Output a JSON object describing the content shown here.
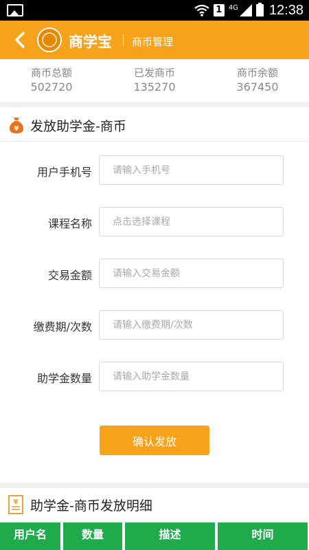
{
  "status_bar": {
    "network": "4G",
    "sim": "1",
    "time": "12:38"
  },
  "header": {
    "back_icon": "chevron-left-icon",
    "logo_icon": "shangxuebao-logo-icon",
    "brand": "商学宝",
    "subtitle": "商币管理",
    "color": "#f7a21b"
  },
  "stats": [
    {
      "label": "商币总额",
      "value": "502720"
    },
    {
      "label": "已发商币",
      "value": "135270"
    },
    {
      "label": "商币余额",
      "value": "367450"
    }
  ],
  "issue_section": {
    "icon": "money-bag-icon",
    "title": "发放助学金-商币",
    "fields": {
      "phone": {
        "label": "用户手机号",
        "placeholder": "请输入手机号",
        "value": ""
      },
      "course": {
        "label": "课程名称",
        "placeholder": "点击选择课程",
        "value": ""
      },
      "amount": {
        "label": "交易金额",
        "placeholder": "请输入交易金额",
        "value": ""
      },
      "period": {
        "label": "缴费期/次数",
        "placeholder": "请输入缴费期/次数",
        "value": ""
      },
      "quantity": {
        "label": "助学金数量",
        "placeholder": "请输入助学金数量",
        "value": ""
      }
    },
    "confirm_label": "确认发放"
  },
  "detail_section": {
    "icon": "yuan-document-icon",
    "title": "助学金-商币发放明细",
    "columns": [
      "用户名",
      "数量",
      "描述",
      "时间"
    ],
    "header_color": "#1faa4c"
  }
}
